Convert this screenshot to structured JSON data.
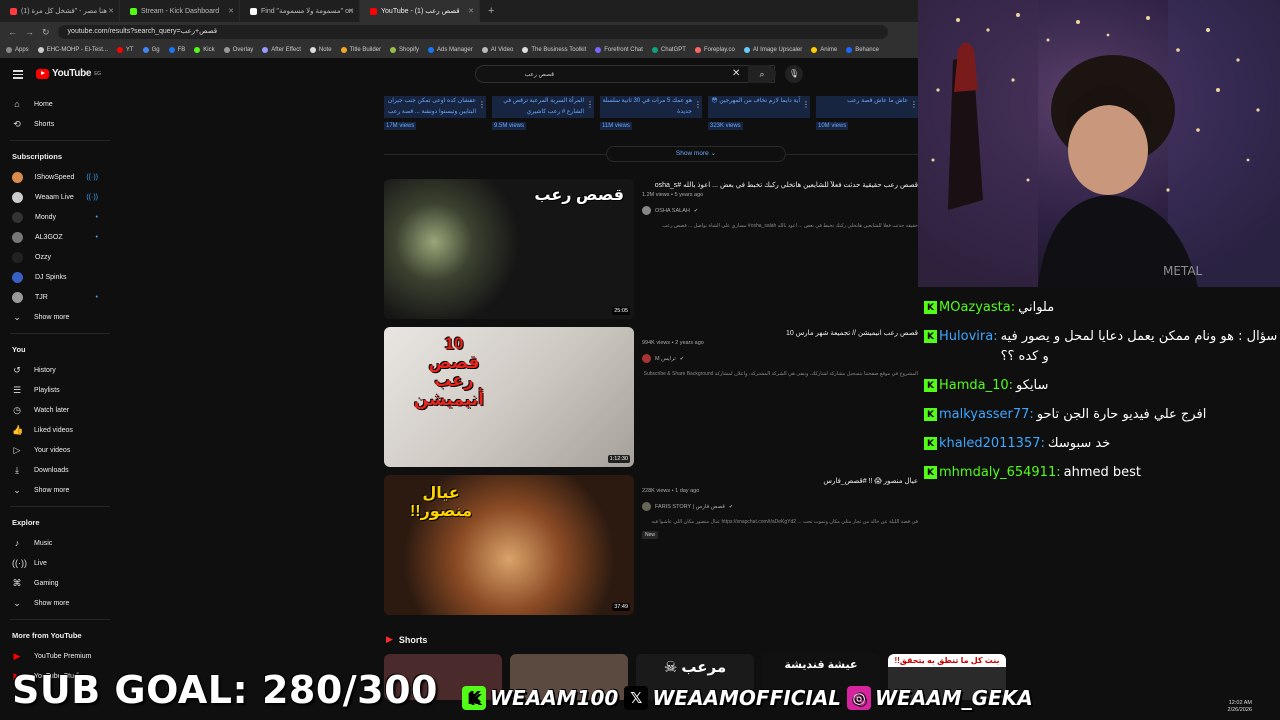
{
  "browser": {
    "tabs": [
      {
        "label": "(1) هنا مصر - \"فشخل كل مرة",
        "color": "#ff3b3b",
        "active": false
      },
      {
        "label": "Stream - Kick Dashboard",
        "color": "#53fc18",
        "active": false
      },
      {
        "label": "Find \"مسمومة ولا مسمومة\" on",
        "color": "#ffffff",
        "active": false
      },
      {
        "label": "YouTube - (1) قصص رعب",
        "color": "#ff0000",
        "active": true
      }
    ],
    "new_tab": "+",
    "url": "youtube.com/results?search_query=قصص+رعب",
    "bookmarks": [
      {
        "label": "Apps",
        "color": "#888888"
      },
      {
        "label": "EHC-MOHP - El-Test...",
        "color": "#cccccc"
      },
      {
        "label": "YT",
        "color": "#ff0000"
      },
      {
        "label": "Gg",
        "color": "#4285f4"
      },
      {
        "label": "FB",
        "color": "#1877f2"
      },
      {
        "label": "Kick",
        "color": "#53fc18"
      },
      {
        "label": "Overlay",
        "color": "#999999"
      },
      {
        "label": "After Effect",
        "color": "#9999ff"
      },
      {
        "label": "Note",
        "color": "#dddddd"
      },
      {
        "label": "Title Builder",
        "color": "#f5a623"
      },
      {
        "label": "Shopify",
        "color": "#95bf47"
      },
      {
        "label": "Ads Manager",
        "color": "#1877f2"
      },
      {
        "label": "AI Video",
        "color": "#bbbbbb"
      },
      {
        "label": "The Business Toolkit",
        "color": "#dddddd"
      },
      {
        "label": "Forefront Chat",
        "color": "#7766ff"
      },
      {
        "label": "ChatGPT",
        "color": "#10a37f"
      },
      {
        "label": "Foreplay.co",
        "color": "#ff6666"
      },
      {
        "label": "AI Image Upscaler",
        "color": "#66ccff"
      },
      {
        "label": "Anime",
        "color": "#ffcc00"
      },
      {
        "label": "Behance",
        "color": "#1769ff"
      }
    ]
  },
  "youtube": {
    "logo": "YouTube",
    "logo_country": "EG",
    "search_value": "قصص رعب",
    "sidebar": {
      "main": [
        {
          "label": "Home",
          "icon": "⌂"
        },
        {
          "label": "Shorts",
          "icon": "⟲"
        }
      ],
      "subscriptions_title": "Subscriptions",
      "subscriptions": [
        {
          "label": "IShowSpeed",
          "color": "#d88b4a",
          "dot": "((·))"
        },
        {
          "label": "Weaam Live",
          "color": "#cccccc",
          "dot": "((·))"
        },
        {
          "label": "Mondy",
          "color": "#333333",
          "dot": "•"
        },
        {
          "label": "AL3GOZ",
          "color": "#777777",
          "dot": "•"
        },
        {
          "label": "Ozzy",
          "color": "#222222",
          "dot": ""
        },
        {
          "label": "DJ Spinks",
          "color": "#3a5fc4",
          "dot": ""
        },
        {
          "label": "TJR",
          "color": "#999999",
          "dot": "•"
        }
      ],
      "subs_show_more": "Show more",
      "you_title": "You",
      "you": [
        {
          "label": "History",
          "icon": "↺"
        },
        {
          "label": "Playlists",
          "icon": "☰"
        },
        {
          "label": "Watch later",
          "icon": "◷"
        },
        {
          "label": "Liked videos",
          "icon": "👍"
        },
        {
          "label": "Your videos",
          "icon": "▷"
        },
        {
          "label": "Downloads",
          "icon": "⤓"
        }
      ],
      "you_show_more": "Show more",
      "explore_title": "Explore",
      "explore": [
        {
          "label": "Music",
          "icon": "♪"
        },
        {
          "label": "Live",
          "icon": "((·))"
        },
        {
          "label": "Gaming",
          "icon": "⌘"
        }
      ],
      "explore_show_more": "Show more",
      "more_title": "More from YouTube",
      "more": [
        {
          "label": "YouTube Premium",
          "icon": "▶"
        },
        {
          "label": "YouTube Studio",
          "icon": "▶"
        }
      ]
    },
    "shelf": [
      {
        "title": "عفشان كده اوعى تمكن جنب جيران البتابين وتيستوا دونشة ... قصة رعب",
        "views": "17M views"
      },
      {
        "title": "المرأة السرية المرعبة ترقص في الشارع # رعب كاشيري",
        "views": "9.5M views"
      },
      {
        "title": "هو عمك 5 مرات في 30 ثانية سلسلة جديدة",
        "views": "11M views"
      },
      {
        "title": "آية دايما لازم تخاف من المهرجين 😳",
        "views": "323K views"
      },
      {
        "title": "عاش ما عاش قصة رعب",
        "views": "10M views"
      }
    ],
    "show_more": "Show more",
    "videos": [
      {
        "title": "قصص رعب حقيقية حدثت فعلاً للشايعين هاتخلي ركبك تخبط في بعض ... اعوذ بالله #osha_s",
        "stats": "1.2M views • 5 years ago",
        "channel": "OSHA SALAH",
        "desc": "حقيقة حدثت فعلا للشايعين هاتخلي ركبك تخبط في بعض ... اعوذ بالله osha_salah# مساري على الشاة تواصل ... قصص رعب",
        "duration": "25:05",
        "badge": "",
        "thumb_text": "قصص رعب"
      },
      {
        "title": "قصص رعب انيميشن // تجميعة شهر مارس 10",
        "stats": "994K views • 2 years ago",
        "channel": "M ترايس",
        "desc": "المشروع في موقع صفحتنا بتسجيل مشاركة لشاركك، وتبقى هي الشركة المشتركة، واعلان لمشاركة Like & Subscribe & Share Background",
        "duration": "1:12:30",
        "badge": "",
        "thumb_text": "10 قصص رعب أنيميشن"
      },
      {
        "title": "عيال منصور 😱 !! #قصص_فارس",
        "stats": "228K views • 1 day ago",
        "channel": "FARIS STORY | قصص فارس",
        "desc": "في قصة الليلة عن خالد من تجار مثلي مكان وتموت تحت ... https://snapchat.com/t/aDeKgYd2 عيال منصور مكان اللي عاشوا فيه",
        "duration": "37:49",
        "badge": "New",
        "thumb_text": "عيال منصور!!"
      }
    ],
    "shorts_title": "Shorts",
    "shorts": [
      {
        "text": ""
      },
      {
        "text": ""
      },
      {
        "text": "مرعب ☠"
      },
      {
        "text": "عيشة قنديشة"
      },
      {
        "text": "بنت كل ما تنطق به يتحقق!!"
      }
    ]
  },
  "chat": [
    {
      "user": "MOazyasta:",
      "text": "ملواني",
      "color": "#53fc18"
    },
    {
      "user": "Hulovira:",
      "text": "سؤال : هو ونام ممكن يعمل دعايا لمحل و يصور فيه و كده ؟؟",
      "color": "#3ea6ff"
    },
    {
      "user": "Hamda_10:",
      "text": "سايكو",
      "color": "#53fc18"
    },
    {
      "user": "malkyasser77:",
      "text": "افرج علي فيديو حارة الجن تاحو",
      "color": "#3ea6ff"
    },
    {
      "user": "khaled2011357:",
      "text": "خد سبوسك",
      "color": "#3ea6ff"
    },
    {
      "user": "mhmdaly_654911:",
      "text": "ahmed best",
      "color": "#53fc18"
    }
  ],
  "overlay": {
    "sub_goal": "SUB GOAL: 280/300",
    "socials": [
      {
        "handle": "WEAAM100",
        "icon": "K",
        "color": "#53fc18",
        "icon_color": "#000000"
      },
      {
        "handle": "WEAAMOFFICIAL",
        "icon": "𝕏",
        "color": "#000000",
        "icon_color": "#ffffff"
      },
      {
        "handle": "WEAAM_GEKA",
        "icon": "◎",
        "color": "#d6249f",
        "icon_color": "#ffffff"
      }
    ]
  },
  "taskbar": {
    "time": "12:02 AM",
    "date": "2/26/2026"
  }
}
